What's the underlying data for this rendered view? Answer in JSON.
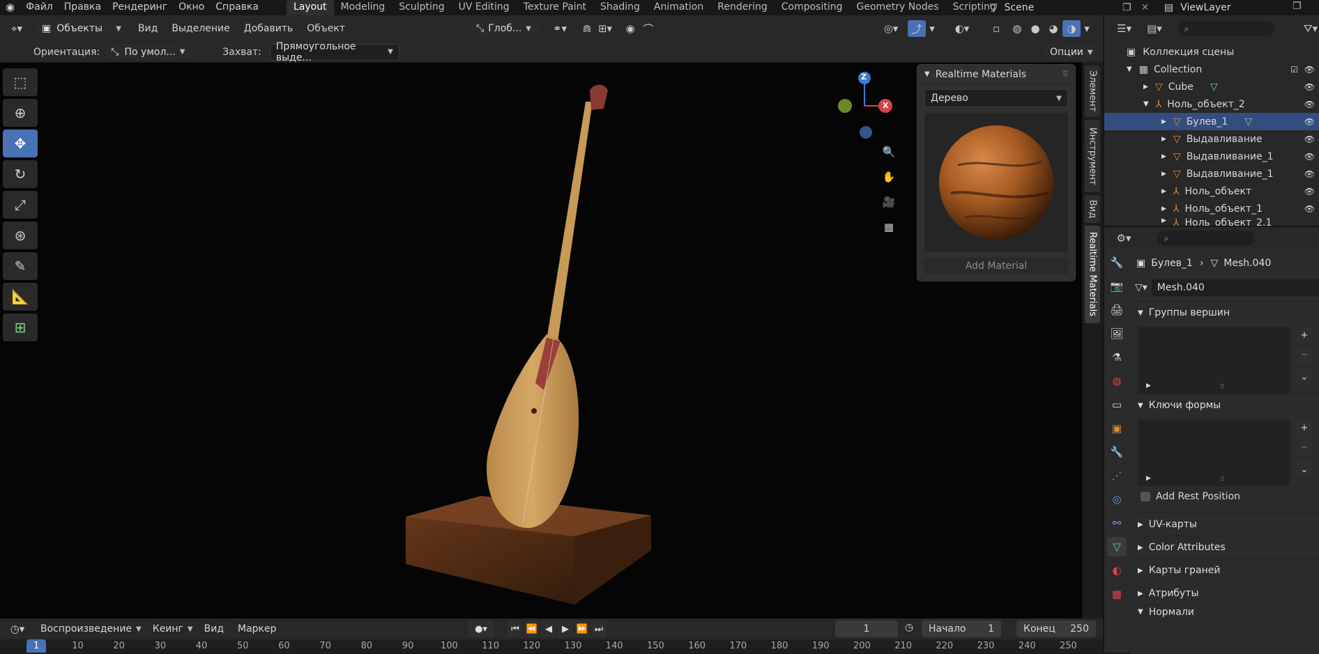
{
  "menubar": {
    "items": [
      "Файл",
      "Правка",
      "Рендеринг",
      "Окно",
      "Справка"
    ],
    "workspaces": [
      "Layout",
      "Modeling",
      "Sculpting",
      "UV Editing",
      "Texture Paint",
      "Shading",
      "Animation",
      "Rendering",
      "Compositing",
      "Geometry Nodes",
      "Scripting"
    ],
    "scene": "Scene",
    "view_layer": "ViewLayer"
  },
  "viewport_header": {
    "mode": "Объекты",
    "menus": [
      "Вид",
      "Выделение",
      "Добавить",
      "Объект"
    ],
    "transform_orientation": "Глоб...",
    "orientation_label": "Ориентация:",
    "orientation_value": "По умол...",
    "snap_label": "Захват:",
    "snap_value": "Прямоугольное выде...",
    "options": "Опции"
  },
  "gizmo": {
    "z": "Z",
    "x": "X"
  },
  "n_panel_tabs": [
    "Элемент",
    "Инструмент",
    "Вид",
    "Realtime Materials"
  ],
  "realtime_materials": {
    "title": "Realtime Materials",
    "selected": "Дерево",
    "add_button": "Add Material"
  },
  "outliner": {
    "scene_collection": "Коллекция сцены",
    "items": [
      {
        "label": "Collection",
        "depth": 0
      },
      {
        "label": "Cube",
        "depth": 1
      },
      {
        "label": "Ноль_объект_2",
        "depth": 1
      },
      {
        "label": "Булев_1",
        "depth": 2
      },
      {
        "label": "Выдавливание",
        "depth": 2
      },
      {
        "label": "Выдавливание_1",
        "depth": 2
      },
      {
        "label": "Выдавливание_1",
        "depth": 2
      },
      {
        "label": "Ноль_объект",
        "depth": 2
      },
      {
        "label": "Ноль_объект_1",
        "depth": 2
      },
      {
        "label": "Ноль_объект_2.1",
        "depth": 2
      }
    ]
  },
  "properties": {
    "breadcrumb_object": "Булев_1",
    "breadcrumb_mesh": "Mesh.040",
    "mesh_name": "Mesh.040",
    "vertex_groups": "Группы вершин",
    "shape_keys": "Ключи формы",
    "add_rest_position": "Add Rest Position",
    "sections": [
      "UV-карты",
      "Color Attributes",
      "Карты граней",
      "Атрибуты",
      "Нормали"
    ]
  },
  "timeline": {
    "menus": [
      "Воспроизведение",
      "Кеинг",
      "Вид",
      "Маркер"
    ],
    "current_frame": "1",
    "start_label": "Начало",
    "start": "1",
    "end_label": "Конец",
    "end": "250",
    "ticks": [
      "1",
      "10",
      "20",
      "30",
      "40",
      "50",
      "60",
      "70",
      "80",
      "90",
      "100",
      "110",
      "120",
      "130",
      "140",
      "150",
      "160",
      "170",
      "180",
      "190",
      "200",
      "210",
      "220",
      "230",
      "240",
      "250"
    ]
  }
}
